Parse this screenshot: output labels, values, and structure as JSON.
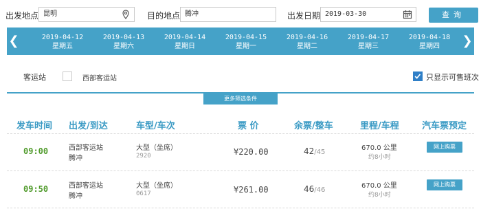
{
  "search": {
    "origin_label": "出发地点",
    "origin_value": "昆明",
    "destination_label": "目的地点",
    "destination_value": "腾冲",
    "date_label": "出发日期",
    "date_value": "2019-03-30",
    "query_label": "查询"
  },
  "date_strip": {
    "dates": [
      {
        "date": "2019-04-12",
        "weekday": "星期五"
      },
      {
        "date": "2019-04-13",
        "weekday": "星期六"
      },
      {
        "date": "2019-04-14",
        "weekday": "星期日"
      },
      {
        "date": "2019-04-15",
        "weekday": "星期一"
      },
      {
        "date": "2019-04-16",
        "weekday": "星期二"
      },
      {
        "date": "2019-04-17",
        "weekday": "星期三"
      },
      {
        "date": "2019-04-18",
        "weekday": "星期四"
      }
    ],
    "prev_icon": "chevron-left-icon",
    "next_icon": "chevron-right-icon"
  },
  "filters": {
    "station_label": "客运站",
    "station_option": "西部客运站",
    "station_checked": false,
    "sellable_only_label": "只显示可售班次",
    "sellable_only_checked": true,
    "more_filters_label": "更多筛选条件"
  },
  "table": {
    "headers": [
      "发车时间",
      "出发/到达",
      "车型/车次",
      "票 价",
      "余票/整车",
      "里程/车程",
      "汽车票预定"
    ],
    "rows": [
      {
        "time": "09:00",
        "from": "西部客运站",
        "to": "腾冲",
        "bus_type": "大型（坐席）",
        "bus_no": "2920",
        "price": "¥220.00",
        "seats_left": "42",
        "seats_total": "/45",
        "distance": "670.0 公里",
        "duration": "约8小时",
        "buy_label": "网上购票"
      },
      {
        "time": "09:50",
        "from": "西部客运站",
        "to": "腾冲",
        "bus_type": "大型（坐席）",
        "bus_no": "0617",
        "price": "¥261.00",
        "seats_left": "46",
        "seats_total": "/46",
        "distance": "670.0 公里",
        "duration": "约8小时",
        "buy_label": "网上购票"
      }
    ]
  },
  "colors": {
    "accent": "#45a2c8",
    "time_green": "#4f9a2a",
    "header_blue": "#3a9ac4"
  }
}
